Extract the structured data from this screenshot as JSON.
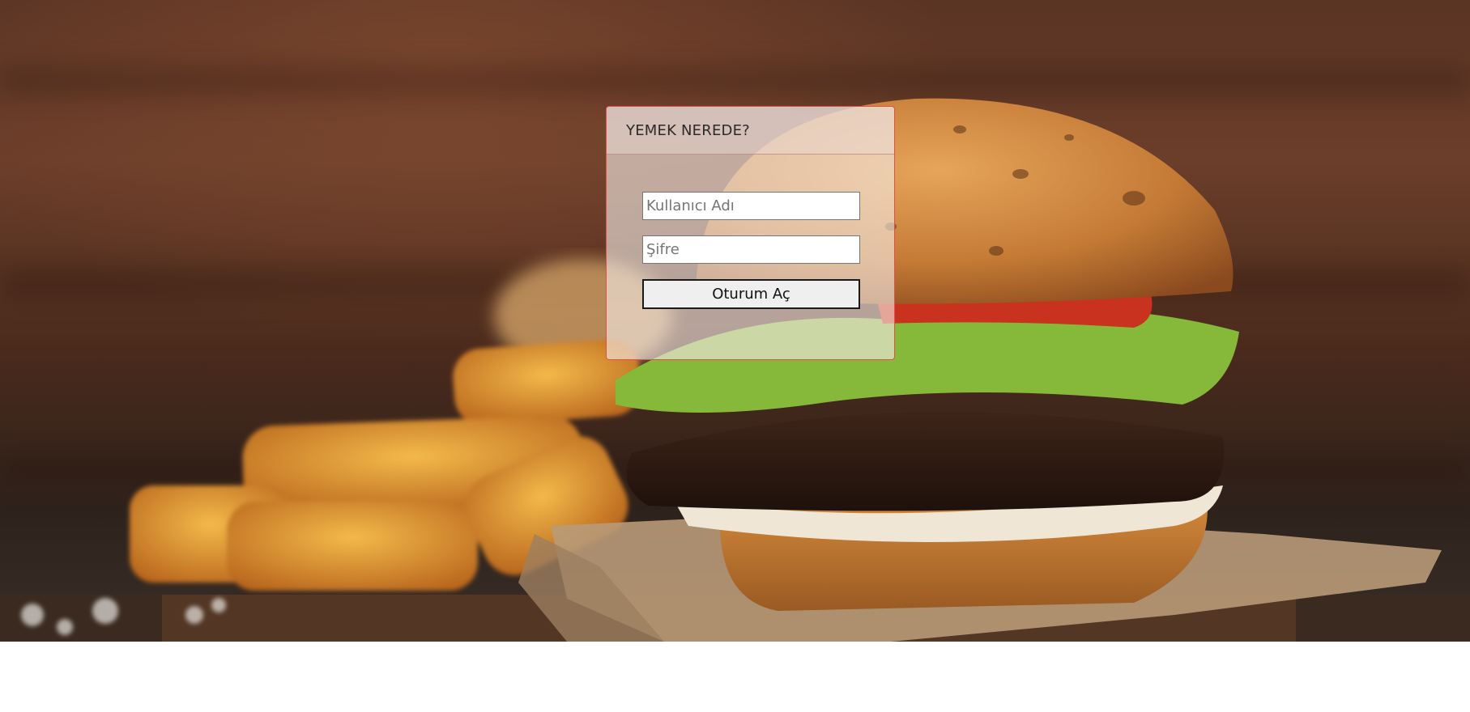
{
  "login": {
    "title": "YEMEK NEREDE?",
    "username_placeholder": "Kullanıcı Adı",
    "password_placeholder": "Şifre",
    "submit_label": "Oturum Aç"
  },
  "colors": {
    "panel_border": "#d9534f",
    "button_background": "#efefef",
    "page_background": "#ffffff"
  }
}
